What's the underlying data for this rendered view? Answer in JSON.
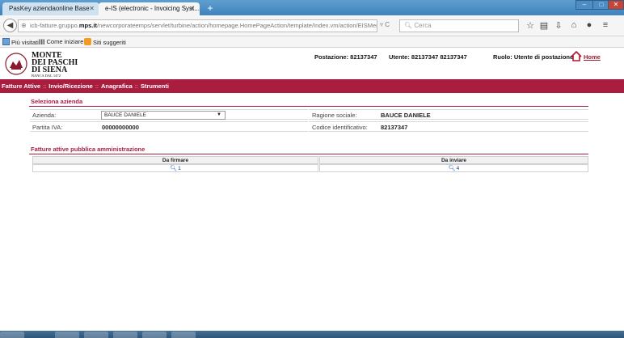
{
  "browser": {
    "tabs": [
      {
        "label": "PasKey aziendaonline Base",
        "active": false
      },
      {
        "label": "e-IS (electronic - Invoicing Syst...",
        "active": true
      }
    ],
    "newtab_symbol": "+",
    "url_prefix": "icb-fatture.gruppo.",
    "url_domain": "mps.it",
    "url_rest": "/newcorporateemps/servlet/turbine/action/homepage.HomePageAction/template/Index.vm/action/EISMenuClick",
    "search_placeholder": "Cerca",
    "bookmarks": [
      {
        "label": "Più visitati",
        "icon": "folder-icon"
      },
      {
        "label": "Come iniziare",
        "icon": "firefox-icon"
      },
      {
        "label": "Siti suggeriti",
        "icon": "suggested-sites-icon"
      }
    ]
  },
  "header": {
    "logo_line1": "MONTE",
    "logo_line2": "DEI PASCHI",
    "logo_line3": "DI SIENA",
    "logo_sub": "BANCA DAL 1472",
    "postazione": "Postazione: 82137347",
    "utente": "Utente: 82137347 82137347",
    "ruolo": "Ruolo: Utente di postazione",
    "home_label": "Home"
  },
  "menu": {
    "items": [
      "Fatture Attive",
      "Invio/Ricezione",
      "Anagrafica",
      "Strumenti"
    ],
    "separator": "::"
  },
  "seleziona": {
    "title": "Seleziona azienda",
    "azienda_label": "Azienda:",
    "azienda_value": "BAUCE DANIELE",
    "ragione_label": "Ragione sociale:",
    "ragione_value": "BAUCE DANIELE",
    "piva_label": "Partita IVA:",
    "piva_value": "00000000000",
    "codice_label": "Codice identificativo:",
    "codice_value": "82137347"
  },
  "fatture": {
    "title": "Fatture attive pubblica amministrazione",
    "columns": [
      "Da firmare",
      "Da inviare"
    ],
    "values": [
      "1",
      "4"
    ]
  },
  "colors": {
    "brand_red": "#a91e3f",
    "link_blue": "#0d3f8c"
  }
}
